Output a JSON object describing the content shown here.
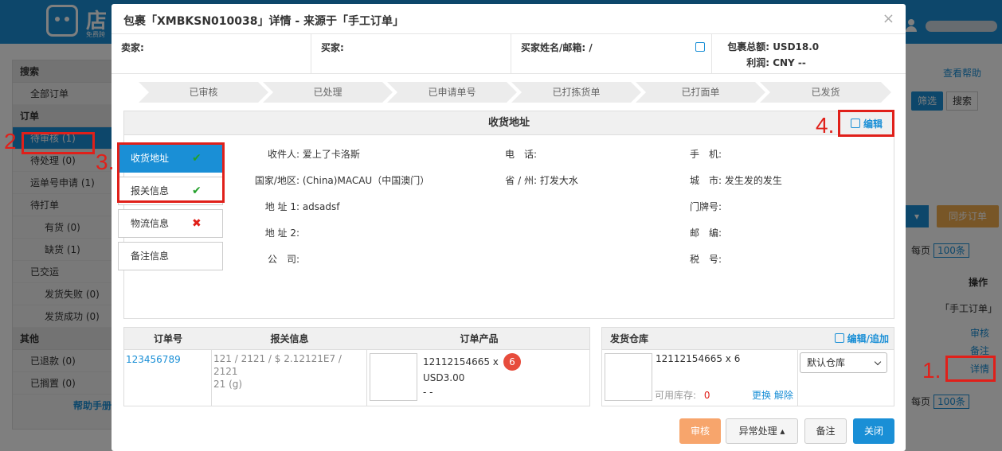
{
  "app": {
    "logo_text": "店",
    "logo_sub": "免费跨",
    "help_link": "查看帮助",
    "filter_button": "筛选",
    "search_button": "搜索",
    "caret": "▾",
    "sync_button": "同步订单",
    "per_page_label": "每页",
    "per_page_value": "100条",
    "operation_header": "操作",
    "manual_tag": "「手工订单」",
    "row_links": [
      "审核",
      "备注",
      "详情"
    ]
  },
  "sidebar": {
    "search_head": "搜索",
    "all_orders": "全部订单",
    "orders_head": "订单",
    "items": [
      {
        "label": "待审核 (1)",
        "sub": false,
        "active": true
      },
      {
        "label": "待处理 (0)",
        "sub": false,
        "active": false
      },
      {
        "label": "运单号申请 (1)",
        "sub": false,
        "active": false
      },
      {
        "label": "待打单",
        "sub": false,
        "active": false
      },
      {
        "label": "有货 (0)",
        "sub": true,
        "active": false
      },
      {
        "label": "缺货 (1)",
        "sub": true,
        "active": false
      },
      {
        "label": "已交运",
        "sub": false,
        "active": false
      },
      {
        "label": "发货失败 (0)",
        "sub": true,
        "active": false
      },
      {
        "label": "发货成功 (0)",
        "sub": true,
        "active": false
      }
    ],
    "other_head": "其他",
    "other_items": [
      "已退款 (0)",
      "已搁置 (0)"
    ],
    "help_manual": "帮助手册"
  },
  "annotations": [
    "1.",
    "2",
    "3.",
    "4."
  ],
  "modal": {
    "title": "包裹「XMBKSN010038」详情 - 来源于「手工订单」",
    "close": "×",
    "seller_label": "卖家:",
    "buyer_label": "买家:",
    "buyer_name_label": "买家姓名/邮箱: /",
    "total_label": "包裹总额:",
    "total_value": "USD18.0",
    "profit_label": "利润:",
    "profit_value": "CNY --",
    "steps": [
      "已审核",
      "已处理",
      "已申请单号",
      "已打拣货单",
      "已打面单",
      "已发货"
    ],
    "address_title": "收货地址",
    "edit_label": "编辑",
    "tabs": [
      {
        "label": "收货地址",
        "status": "✔",
        "status_type": "ok"
      },
      {
        "label": "报关信息",
        "status": "✔",
        "status_type": "ok"
      },
      {
        "label": "物流信息",
        "status": "✖",
        "status_type": "bad"
      },
      {
        "label": "备注信息",
        "status": "",
        "status_type": "none"
      }
    ],
    "fields": {
      "recipient_label": "收件人:",
      "recipient_value": "爱上了卡洛斯",
      "phone_label": "电　话:",
      "phone_value": "",
      "mobile_label": "手　机:",
      "mobile_value": "",
      "country_label": "国家/地区:",
      "country_value": "(China)MACAU（中国澳门）",
      "province_label": "省 / 州:",
      "province_value": "打发大水",
      "city_label": "城　市:",
      "city_value": "发生发的发生",
      "address1_label": "地 址 1:",
      "address1_value": "adsadsf",
      "doorplate_label": "门牌号:",
      "doorplate_value": "",
      "address2_label": "地 址 2:",
      "address2_value": "",
      "zip_label": "邮　编:",
      "zip_value": "",
      "company_label": "公　司:",
      "company_value": "",
      "tax_label": "税　号:",
      "tax_value": ""
    },
    "order_table": {
      "headers": [
        "订单号",
        "报关信息",
        "订单产品"
      ],
      "order_no": "123456789",
      "customs_line1": "121 / 2121 / $ 2.12121E7 / 2121",
      "customs_line2": "21 (g)",
      "product_sku": "12112154665 x",
      "product_qty": "6",
      "product_price": "USD3.00",
      "product_dash": "- -"
    },
    "warehouse": {
      "title": "发货仓库",
      "edit_add": "编辑/追加",
      "item": "12112154665 x 6",
      "stock_label": "可用库存:",
      "stock_value": "0",
      "replace": "更换",
      "remove": "解除",
      "select_value": "默认仓库"
    },
    "footer": {
      "audit": "审核",
      "exception": "异常处理 ▴",
      "note": "备注",
      "close": "关闭"
    }
  }
}
